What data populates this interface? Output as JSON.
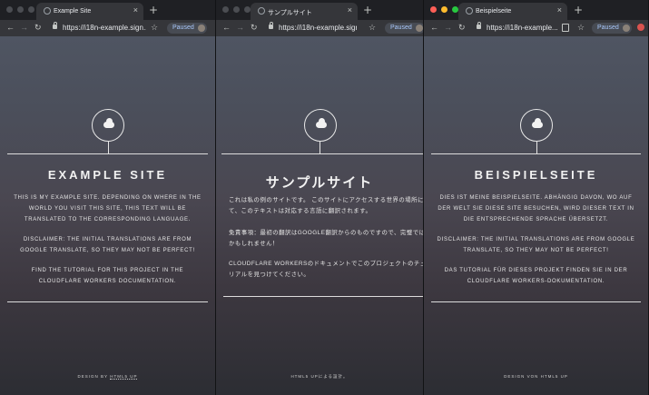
{
  "windows": [
    {
      "tab_title": "Example Site",
      "url": "https://i18n-example.sign...",
      "paused_label": "Paused",
      "page": {
        "title": "EXAMPLE SITE",
        "paragraphs": [
          "THIS IS MY EXAMPLE SITE. DEPENDING ON WHERE IN THE WORLD YOU VISIT THIS SITE, THIS TEXT WILL BE TRANSLATED TO THE CORRESPONDING LANGUAGE.",
          "DISCLAIMER: THE INITIAL TRANSLATIONS ARE FROM GOOGLE TRANSLATE, SO THEY MAY NOT BE PERFECT!",
          "FIND THE TUTORIAL FOR THIS PROJECT IN THE CLOUDFLARE WORKERS DOCUMENTATION."
        ],
        "footer_prefix": "DESIGN BY ",
        "footer_link": "HTML5 UP"
      }
    },
    {
      "tab_title": "サンプルサイト",
      "url": "https://i18n-example.sign...",
      "paused_label": "Paused",
      "page": {
        "title": "サンプルサイト",
        "paragraphs": [
          "これは私の例のサイトです。 このサイトにアクセスする世界の場所に応じて、このテキストは対応する言語に翻訳されます。",
          "免責事項：最初の翻訳はGOOGLE翻訳からのものですので、完璧ではないかもしれません！",
          "CLOUDFLARE WORKERSのドキュメントでこのプロジェクトのチュートリアルを見つけてください。"
        ],
        "footer_prefix": "HTML5 UPによる設計。",
        "footer_link": ""
      }
    },
    {
      "tab_title": "Beispielseite",
      "url": "https://i18n-example...",
      "paused_label": "Paused",
      "page": {
        "title": "BEISPIELSEITE",
        "paragraphs": [
          "DIES IST MEINE BEISPIELSEITE. ABHÄNGIG DAVON, WO AUF DER WELT SIE DIESE SITE BESUCHEN, WIRD DIESER TEXT IN DIE ENTSPRECHENDE SPRACHE ÜBERSETZT.",
          "DISCLAIMER: THE INITIAL TRANSLATIONS ARE FROM GOOGLE TRANSLATE, SO THEY MAY NOT BE PERFECT!",
          "DAS TUTORIAL FÜR DIESES PROJEKT FINDEN SIE IN DER CLOUDFLARE WORKERS-DOKUMENTATION."
        ],
        "footer_prefix": "DESIGN VON HTML5 UP",
        "footer_link": ""
      }
    }
  ],
  "icons": {
    "tab_close": "×",
    "new_tab": "+",
    "back": "←",
    "forward": "→",
    "reload": "↻",
    "star": "☆"
  }
}
